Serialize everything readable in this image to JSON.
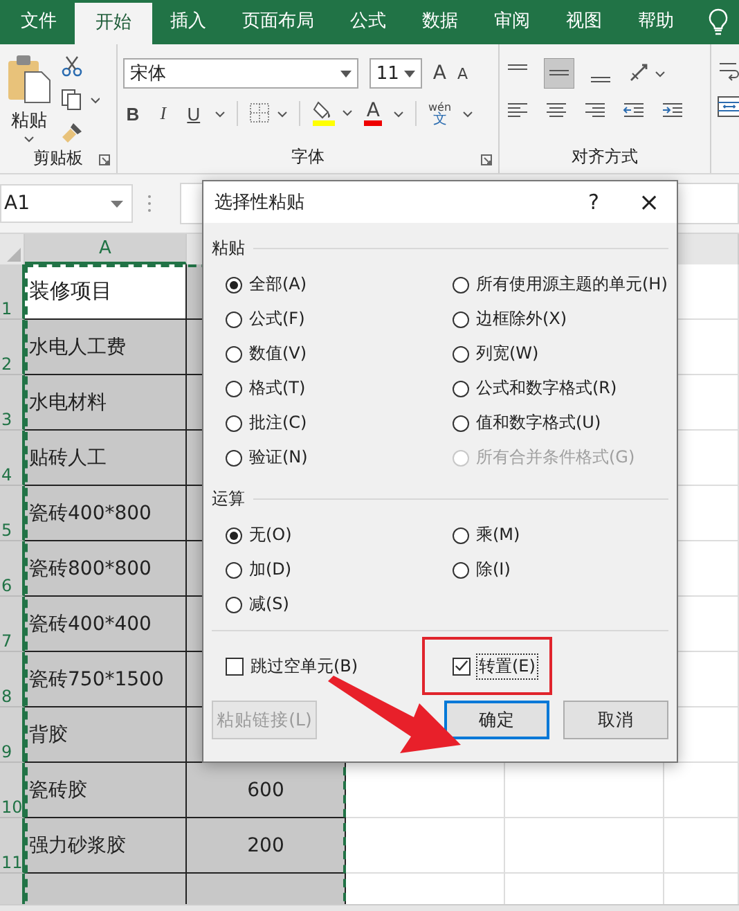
{
  "ribbon_tabs": [
    {
      "label": "文件",
      "selected": false
    },
    {
      "label": "开始",
      "selected": true
    },
    {
      "label": "插入",
      "selected": false
    },
    {
      "label": "页面布局",
      "selected": false
    },
    {
      "label": "公式",
      "selected": false
    },
    {
      "label": "数据",
      "selected": false
    },
    {
      "label": "审阅",
      "selected": false
    },
    {
      "label": "视图",
      "selected": false
    },
    {
      "label": "帮助",
      "selected": false
    }
  ],
  "ribbon": {
    "paste_label": "粘贴",
    "font_name": "宋体",
    "font_size": "11",
    "size_buttons": [
      {
        "label": "A",
        "kind": "grow"
      },
      {
        "label": "A",
        "kind": "shrink"
      }
    ],
    "style_buttons": [
      {
        "label": "B",
        "kind": "bold"
      },
      {
        "label": "I",
        "kind": "italic"
      },
      {
        "label": "U",
        "kind": "underline"
      }
    ],
    "font_color_label": "A",
    "phonetic_top": "wén",
    "phonetic_bottom": "文",
    "groups": [
      "剪贴板",
      "字体",
      "对齐方式"
    ]
  },
  "name_box": "A1",
  "sheet": {
    "column_header": "A",
    "rows": [
      {
        "number": "1",
        "a": "装修项目",
        "active": true
      },
      {
        "number": "2",
        "a": "水电人工费",
        "active": false
      },
      {
        "number": "3",
        "a": "水电材料",
        "active": false
      },
      {
        "number": "4",
        "a": "贴砖人工",
        "active": false
      },
      {
        "number": "5",
        "a": "瓷砖400*800",
        "active": false
      },
      {
        "number": "6",
        "a": "瓷砖800*800",
        "active": false
      },
      {
        "number": "7",
        "a": "瓷砖400*400",
        "active": false
      },
      {
        "number": "8",
        "a": "瓷砖750*1500",
        "active": false
      },
      {
        "number": "9",
        "a": "背胶",
        "active": false
      },
      {
        "number": "10",
        "a": "瓷砖胶",
        "b": "600",
        "active": false
      },
      {
        "number": "11",
        "a": "强力砂浆胶",
        "b": "200",
        "active": false
      }
    ]
  },
  "dialog": {
    "title": "选择性粘贴",
    "help": "?",
    "close": "×",
    "paste_section": "粘贴",
    "paste_options": [
      {
        "label": "全部(A)",
        "selected": true,
        "disabled": false
      },
      {
        "label": "所有使用源主题的单元(H)",
        "selected": false,
        "disabled": false
      },
      {
        "label": "公式(F)",
        "selected": false,
        "disabled": false
      },
      {
        "label": "边框除外(X)",
        "selected": false,
        "disabled": false
      },
      {
        "label": "数值(V)",
        "selected": false,
        "disabled": false
      },
      {
        "label": "列宽(W)",
        "selected": false,
        "disabled": false
      },
      {
        "label": "格式(T)",
        "selected": false,
        "disabled": false
      },
      {
        "label": "公式和数字格式(R)",
        "selected": false,
        "disabled": false
      },
      {
        "label": "批注(C)",
        "selected": false,
        "disabled": false
      },
      {
        "label": "值和数字格式(U)",
        "selected": false,
        "disabled": false
      },
      {
        "label": "验证(N)",
        "selected": false,
        "disabled": false
      },
      {
        "label": "所有合并条件格式(G)",
        "selected": false,
        "disabled": true
      }
    ],
    "operation_section": "运算",
    "operation_options": [
      {
        "label": "无(O)",
        "selected": true
      },
      {
        "label": "乘(M)",
        "selected": false
      },
      {
        "label": "加(D)",
        "selected": false
      },
      {
        "label": "除(I)",
        "selected": false
      },
      {
        "label": "减(S)",
        "selected": false
      }
    ],
    "skip_blanks": {
      "label": "跳过空单元(B)",
      "checked": false
    },
    "transpose": {
      "label": "转置(E)",
      "checked": true
    },
    "buttons": [
      {
        "label": "粘贴链接(L)",
        "disabled": true,
        "default": false
      },
      {
        "label": "确定",
        "disabled": false,
        "default": true
      },
      {
        "label": "取消",
        "disabled": false,
        "default": false
      }
    ]
  }
}
